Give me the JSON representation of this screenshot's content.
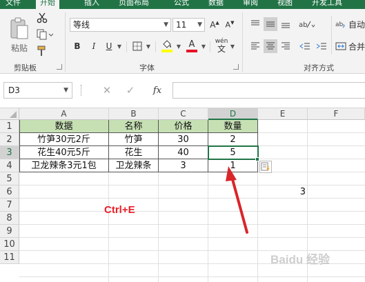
{
  "tabs": [
    {
      "label": "文件",
      "active": false
    },
    {
      "label": "开始",
      "active": true
    },
    {
      "label": "插入",
      "active": false
    },
    {
      "label": "页面布局",
      "active": false
    },
    {
      "label": "公式",
      "active": false
    },
    {
      "label": "数据",
      "active": false
    },
    {
      "label": "审阅",
      "active": false
    },
    {
      "label": "视图",
      "active": false
    },
    {
      "label": "开发工具",
      "active": false
    }
  ],
  "clipboard": {
    "paste_label": "粘贴",
    "group_label": "剪贴板"
  },
  "font": {
    "name": "等线",
    "size": "11",
    "group_label": "字体",
    "bold": "B",
    "italic": "I",
    "underline": "U",
    "phonetic": "wén"
  },
  "alignment": {
    "group_label": "对齐方式",
    "wrap_label": "自动",
    "merge_label": "合并"
  },
  "formula_bar": {
    "name_box": "D3",
    "fx": "fx",
    "value": ""
  },
  "columns": [
    "A",
    "B",
    "C",
    "D",
    "E",
    "F"
  ],
  "selected_column": "D",
  "rows": [
    "1",
    "2",
    "3",
    "4",
    "5",
    "6",
    "7",
    "8",
    "9",
    "10",
    "11"
  ],
  "selected_row": "3",
  "table": {
    "headers": [
      "数据",
      "名称",
      "价格",
      "数量"
    ],
    "rows": [
      [
        "竹笋30元2斤",
        "竹笋",
        "30",
        "2"
      ],
      [
        "花生40元5斤",
        "花生",
        "40",
        "5"
      ],
      [
        "卫龙辣条3元1包",
        "卫龙辣条",
        "3",
        "1"
      ]
    ]
  },
  "e6_value": "3",
  "annotation": "Ctrl+E",
  "watermark": "Baidu 经验",
  "colors": {
    "excel_green": "#217346",
    "header_fill": "#c6e0b4",
    "annotation_red": "#e8202a",
    "arrow_red": "#d9262b"
  }
}
